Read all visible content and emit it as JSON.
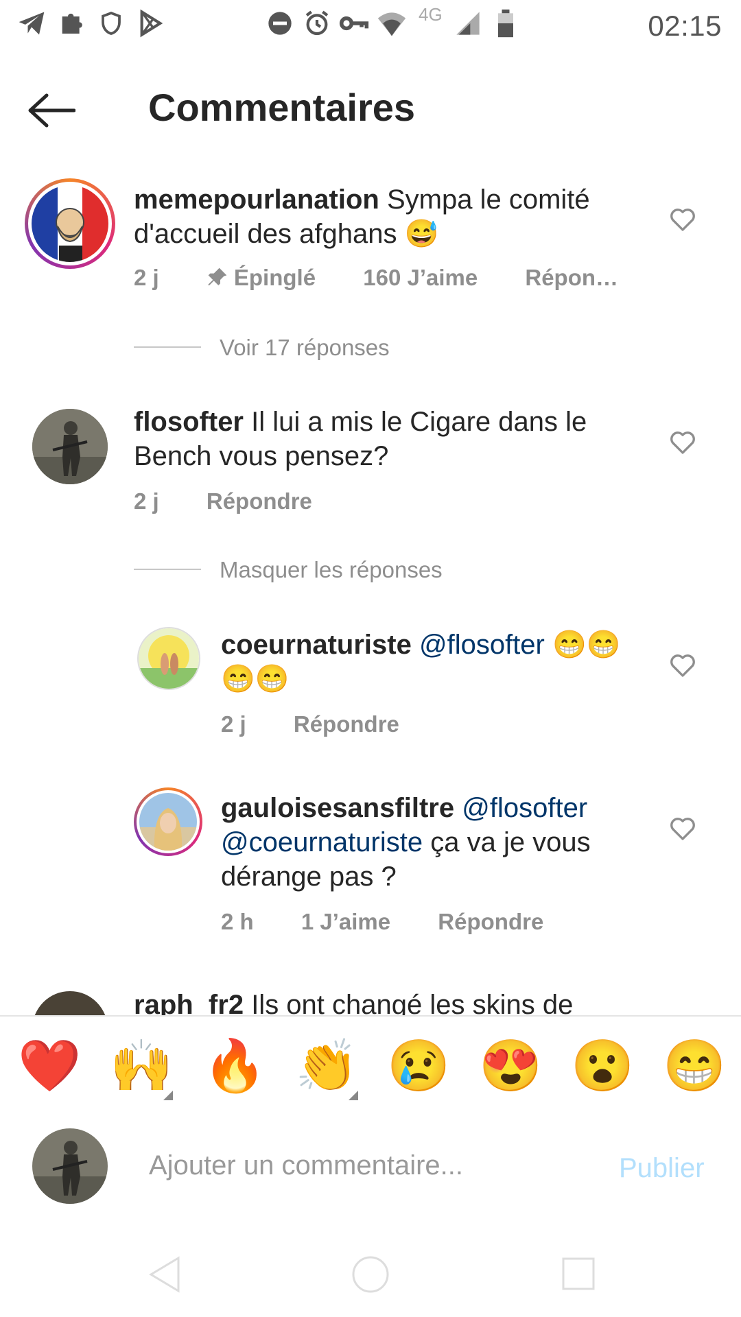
{
  "status_bar": {
    "time": "02:15",
    "network": "4G",
    "icons": [
      "telegram-icon",
      "puzzle-icon",
      "shield-icon",
      "play-store-icon",
      "dnd-icon",
      "alarm-icon",
      "vpn-key-icon",
      "wifi-icon",
      "signal-icon",
      "battery-icon"
    ]
  },
  "header": {
    "title": "Commentaires",
    "back_icon": "arrow-left-icon"
  },
  "comments": [
    {
      "username": "memepourlanation",
      "text": "Sympa le comité d'accueil des afghans 😅",
      "time": "2 j",
      "pinned": "Épinglé",
      "likes": "160 J’aime",
      "reply": "Répon…",
      "view_replies": "Voir 17 réponses"
    },
    {
      "username": "flosofter",
      "text": "Il lui a mis le Cigare dans le Bench vous pensez?",
      "time": "2 j",
      "reply": "Répondre",
      "hide_replies": "Masquer les réponses"
    },
    {
      "username": "coeurnaturiste",
      "mention": "@flosofter",
      "text": "😁😁😁😁",
      "time": "2 j",
      "reply": "Répondre"
    },
    {
      "username": "gauloisesansfiltre",
      "mention1": "@flosofter",
      "mention2": "@coeurnaturiste",
      "text": "ça va je vous dérange pas ?",
      "time": "2 h",
      "likes": "1 J’aime",
      "reply": "Répondre"
    },
    {
      "username": "raph_fr2",
      "text": "Ils ont changé les skins de"
    }
  ],
  "emoji_bar": [
    "❤️",
    "🙌",
    "🔥",
    "👏",
    "😢",
    "😍",
    "😮",
    "😁"
  ],
  "composer": {
    "placeholder": "Ajouter un commentaire...",
    "publish": "Publier"
  },
  "colors": {
    "mention": "#003569",
    "meta": "#8e8e8e",
    "publish_disabled": "#b2dffc"
  }
}
